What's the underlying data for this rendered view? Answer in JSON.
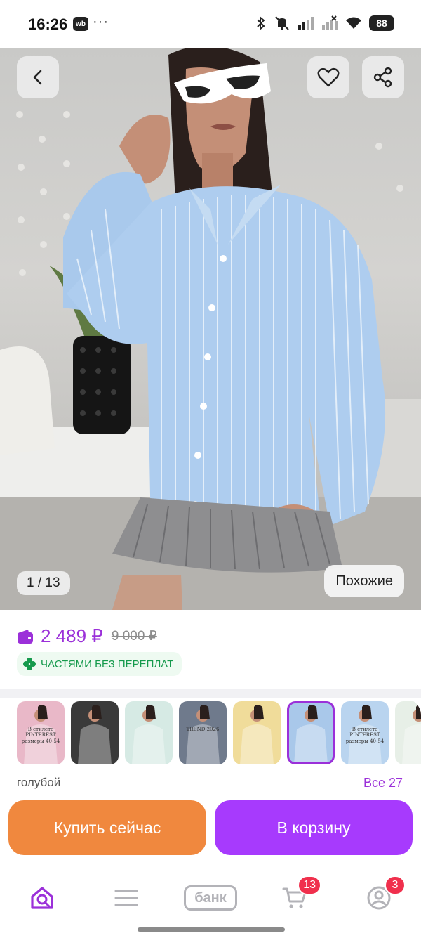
{
  "status_bar": {
    "time": "16:26",
    "app_badge": "wb",
    "overflow": "···",
    "battery": "88",
    "icons": [
      "bluetooth-icon",
      "mute-icon",
      "signal-icon",
      "signal-crossed-icon",
      "wifi-icon",
      "battery-icon"
    ]
  },
  "gallery": {
    "counter": "1 / 13",
    "similar_label": "Похожие",
    "back_icon": "chevron-left-icon",
    "favorite_icon": "heart-icon",
    "share_icon": "share-icon"
  },
  "product": {
    "price": "2 489 ₽",
    "old_price": "9 000 ₽",
    "installment_label": "ЧАСТЯМИ БЕЗ ПЕРЕПЛАТ"
  },
  "variants": {
    "color_name": "голубой",
    "all_link": "Все 27",
    "selected_index": 5,
    "thumbnails": [
      {
        "caption": "В стилете PINTEREST размеры 40-54",
        "bg": "#e9b8c8"
      },
      {
        "caption": "",
        "bg": "#3a3a3a"
      },
      {
        "caption": "",
        "bg": "#d6eae4"
      },
      {
        "caption": "TREND 2026",
        "bg": "#6f7a8c"
      },
      {
        "caption": "",
        "bg": "#f0dc9a"
      },
      {
        "caption": "",
        "bg": "#a9c8ea"
      },
      {
        "caption": "В стилете PINTEREST размеры 40-54",
        "bg": "#b9d4ef"
      },
      {
        "caption": "",
        "bg": "#e7efe7"
      }
    ]
  },
  "actions": {
    "buy_now": "Купить сейчас",
    "add_to_cart": "В корзину"
  },
  "bottom_nav": {
    "bank_label": "банк",
    "cart_badge": "13",
    "profile_badge": "3"
  },
  "colors": {
    "accent": "#9b30d9",
    "buy_now": "#f0883e",
    "cart_button": "#a73afd",
    "badge": "#f0304d",
    "installment": "#159a4c"
  }
}
